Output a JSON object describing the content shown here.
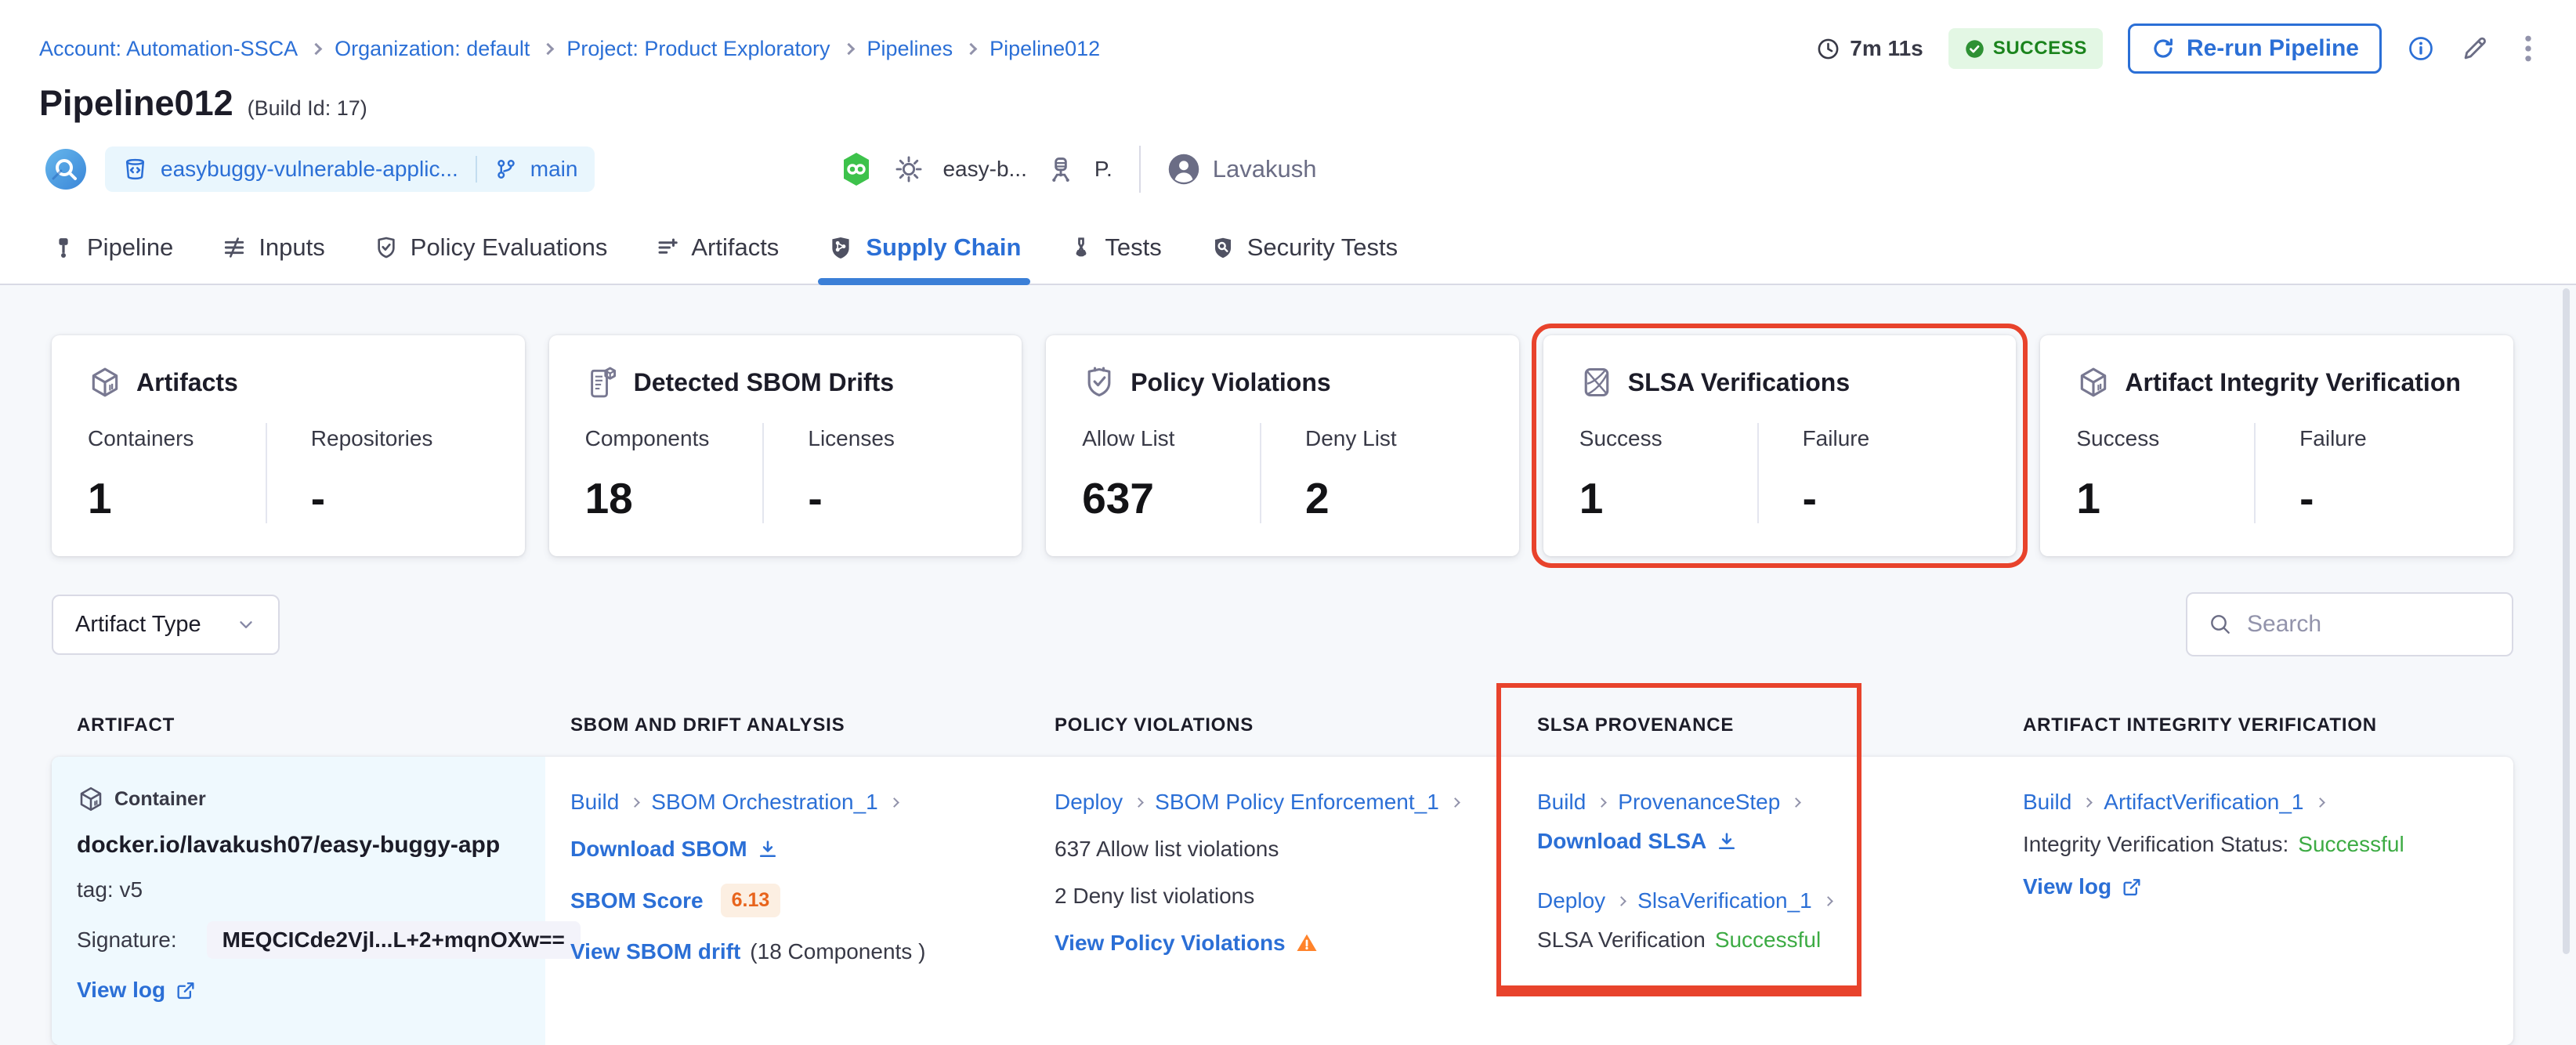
{
  "colors": {
    "accent_blue": "#2b6fd6",
    "success_green": "#3dab44",
    "status_badge_bg": "#e3f7e4",
    "status_badge_text": "#1b841d",
    "highlight_red": "#e8432c",
    "warning_orange": "#ff832b",
    "score_badge_text": "#e8641c",
    "score_badge_bg": "#fcefe2"
  },
  "icons": {
    "clock": "clock-outline",
    "status": "check-circle",
    "rerun": "refresh-arrow",
    "info": "info-circle",
    "edit": "pencil",
    "more": "kebab-vertical",
    "execution": "blue-circle-magnifier",
    "repo": "code-repository",
    "branch": "git-branch",
    "trigger": "green-hexagon-webhook",
    "settings": "gear",
    "delegate": "delegate-server",
    "user": "avatar-person",
    "search": "magnifier",
    "dropdown": "chevron-down",
    "download": "download-arrow",
    "external": "external-link",
    "warning": "warning-triangle"
  },
  "breadcrumb": {
    "items": [
      "Account: Automation-SSCA",
      "Organization: default",
      "Project: Product Exploratory",
      "Pipelines",
      "Pipeline012"
    ]
  },
  "header": {
    "title": "Pipeline012",
    "build_id": "(Build Id: 17)",
    "duration": "7m 11s",
    "status": "SUCCESS",
    "rerun_label": "Re-run Pipeline",
    "repo": "easybuggy-vulnerable-applic...",
    "branch": "main",
    "trigger_text": "easy-b...",
    "trigger_suffix": "P.",
    "user": "Lavakush"
  },
  "tabs": [
    {
      "label": "Pipeline",
      "active": false
    },
    {
      "label": "Inputs",
      "active": false
    },
    {
      "label": "Policy Evaluations",
      "active": false
    },
    {
      "label": "Artifacts",
      "active": false
    },
    {
      "label": "Supply Chain",
      "active": true
    },
    {
      "label": "Tests",
      "active": false
    },
    {
      "label": "Security Tests",
      "active": false
    }
  ],
  "summary_cards": [
    {
      "title": "Artifacts",
      "metrics": [
        {
          "label": "Containers",
          "value": "1"
        },
        {
          "label": "Repositories",
          "value": "-"
        }
      ],
      "highlight": false
    },
    {
      "title": "Detected SBOM Drifts",
      "metrics": [
        {
          "label": "Components",
          "value": "18"
        },
        {
          "label": "Licenses",
          "value": "-"
        }
      ],
      "highlight": false
    },
    {
      "title": "Policy Violations",
      "metrics": [
        {
          "label": "Allow List",
          "value": "637"
        },
        {
          "label": "Deny List",
          "value": "2"
        }
      ],
      "highlight": false
    },
    {
      "title": "SLSA Verifications",
      "metrics": [
        {
          "label": "Success",
          "value": "1"
        },
        {
          "label": "Failure",
          "value": "-"
        }
      ],
      "highlight": true
    },
    {
      "title": "Artifact Integrity Verification",
      "metrics": [
        {
          "label": "Success",
          "value": "1"
        },
        {
          "label": "Failure",
          "value": "-"
        }
      ],
      "highlight": false
    }
  ],
  "filters": {
    "artifact_type_label": "Artifact Type",
    "search_placeholder": "Search"
  },
  "table": {
    "columns": [
      "ARTIFACT",
      "SBOM AND DRIFT ANALYSIS",
      "POLICY VIOLATIONS",
      "SLSA PROVENANCE",
      "ARTIFACT INTEGRITY VERIFICATION"
    ],
    "row": {
      "artifact": {
        "type_label": "Container",
        "image": "docker.io/lavakush07/easy-buggy-app",
        "tag": "tag: v5",
        "signature_label": "Signature:",
        "signature": "MEQCICde2Vjl...L+2+mqnOXw==",
        "view_log": "View log"
      },
      "sbom": {
        "stage": "Build",
        "step": "SBOM Orchestration_1",
        "download_label": "Download SBOM",
        "score_label": "SBOM Score",
        "score": "6.13",
        "drift_link": "View SBOM drift",
        "drift_suffix": "(18 Components )"
      },
      "policy": {
        "stage": "Deploy",
        "step": "SBOM Policy Enforcement_1",
        "allow_text": "637 Allow list violations",
        "deny_text": "2 Deny list violations",
        "link": "View Policy Violations"
      },
      "slsa": {
        "stage1": "Build",
        "step1": "ProvenanceStep",
        "download_label": "Download SLSA",
        "stage2": "Deploy",
        "step2": "SlsaVerification_1",
        "status_label": "SLSA Verification",
        "status_value": "Successful"
      },
      "integrity": {
        "stage": "Build",
        "step": "ArtifactVerification_1",
        "status_label": "Integrity Verification Status:",
        "status_value": "Successful",
        "view_log": "View log"
      }
    }
  }
}
